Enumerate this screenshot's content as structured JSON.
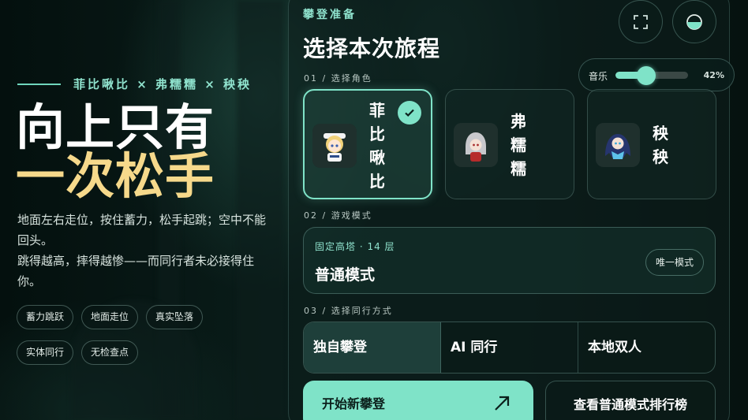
{
  "left": {
    "cast": "菲比啾比 × 弗糯糯 × 秧秧",
    "headline_line1": "向上只有",
    "headline_line2": "一次松手",
    "description_line1": "地面左右走位，按住蓄力，松手起跳；空中不能回头。",
    "description_line2": "跳得越高，摔得越惨——而同行者未必接得住你。",
    "tags": [
      "蓄力跳跃",
      "地面走位",
      "真实坠落",
      "实体同行",
      "无检查点"
    ]
  },
  "panel": {
    "eyebrow": "攀登准备",
    "title": "选择本次旅程",
    "fullscreen_icon": "fullscreen-icon",
    "theme_icon": "theme-toggle-icon",
    "music": {
      "label": "音乐",
      "value_text": "42%",
      "level": 0.42
    },
    "section_role": "01 / 选择角色",
    "characters": [
      {
        "name": "菲比啾比",
        "selected": true
      },
      {
        "name": "弗糯糯",
        "selected": false
      },
      {
        "name": "秧秧",
        "selected": false
      }
    ],
    "section_mode": "02 / 游戏模式",
    "mode": {
      "subtitle": "固定高塔 · 14 层",
      "name": "普通模式",
      "badge": "唯一模式"
    },
    "section_companion": "03 / 选择同行方式",
    "companion_options": [
      "独自攀登",
      "AI 同行",
      "本地双人"
    ],
    "companion_selected": 0,
    "start_label": "开始新攀登",
    "leaderboard_label": "查看普通模式排行榜"
  },
  "colors": {
    "accent": "#7fe3c8",
    "headline_gold": "#f6d98b",
    "bg": "#05110f"
  }
}
